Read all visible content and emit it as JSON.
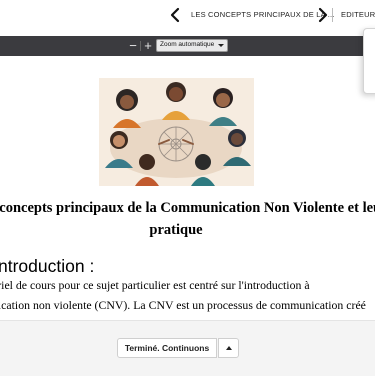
{
  "nav": {
    "title": "LES CONCEPTS PRINCIPAUX DE LA ...",
    "editor_label": "EDITEUR",
    "prev_icon": "chevron-left-icon",
    "next_icon": "chevron-right-icon"
  },
  "pdf_toolbar": {
    "zoom_out_label": "−",
    "zoom_in_label": "+",
    "zoom_value": "Zoom automatique"
  },
  "document": {
    "title_line1": "s concepts principaux de la Communication Non Violente et leur",
    "title_line2": "pratique",
    "section_heading": "ntroduction :",
    "paragraph_line1": "ériel de cours pour ce sujet particulier est centré sur l'introduction à",
    "paragraph_line2": "nication non violente (CNV). La CNV est un processus de communication créé"
  },
  "bottom_bar": {
    "done_label": "Terminé. Continuons",
    "dropdown_icon": "caret-up-icon"
  },
  "colors": {
    "toolbar_bg": "#3b3b3f",
    "bottom_bar_bg": "#f4f4f4",
    "illustration_bg": "#f6ece0"
  }
}
